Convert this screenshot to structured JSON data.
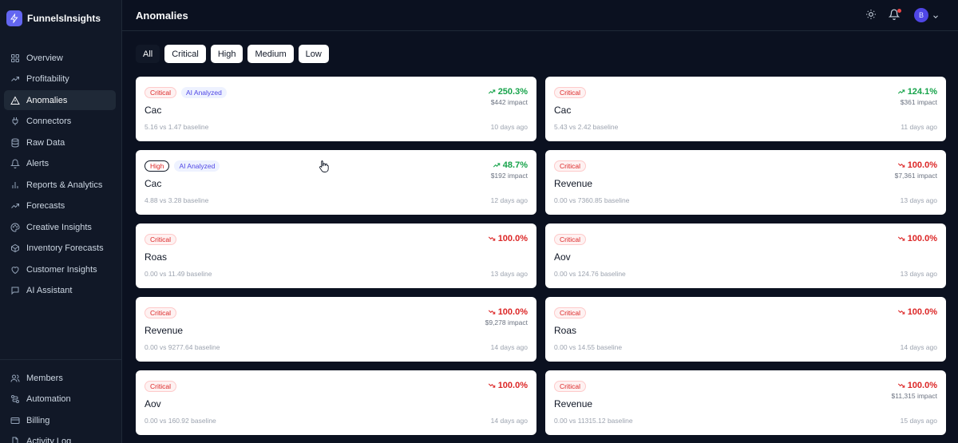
{
  "app": {
    "name": "FunnelsInsights"
  },
  "nav": {
    "items": [
      {
        "label": "Overview",
        "icon": "grid-icon"
      },
      {
        "label": "Profitability",
        "icon": "trending-icon"
      },
      {
        "label": "Anomalies",
        "icon": "alert-triangle-icon",
        "active": true
      },
      {
        "label": "Connectors",
        "icon": "plug-icon"
      },
      {
        "label": "Raw Data",
        "icon": "database-icon"
      },
      {
        "label": "Alerts",
        "icon": "bell-icon"
      },
      {
        "label": "Reports & Analytics",
        "icon": "bar-chart-icon"
      },
      {
        "label": "Forecasts",
        "icon": "trending-icon"
      },
      {
        "label": "Creative Insights",
        "icon": "palette-icon"
      },
      {
        "label": "Inventory Forecasts",
        "icon": "box-icon"
      },
      {
        "label": "Customer Insights",
        "icon": "heart-icon"
      },
      {
        "label": "AI Assistant",
        "icon": "chat-icon"
      }
    ],
    "bottom": [
      {
        "label": "Members",
        "icon": "users-icon"
      },
      {
        "label": "Automation",
        "icon": "workflow-icon"
      },
      {
        "label": "Billing",
        "icon": "credit-card-icon"
      },
      {
        "label": "Activity Log",
        "icon": "file-icon"
      }
    ]
  },
  "header": {
    "title": "Anomalies",
    "avatar_initial": "B"
  },
  "filters": [
    {
      "label": "All",
      "active": true
    },
    {
      "label": "Critical"
    },
    {
      "label": "High"
    },
    {
      "label": "Medium"
    },
    {
      "label": "Low"
    }
  ],
  "cards": [
    {
      "severity": "Critical",
      "ai": "AI Analyzed",
      "metric": "Cac",
      "baseline": "5.16 vs 1.47 baseline",
      "change": "250.3%",
      "direction": "up",
      "impact": "$442 impact",
      "time": "10 days ago"
    },
    {
      "severity": "Critical",
      "ai": "",
      "metric": "Cac",
      "baseline": "5.43 vs 2.42 baseline",
      "change": "124.1%",
      "direction": "up",
      "impact": "$361 impact",
      "time": "11 days ago"
    },
    {
      "severity": "High",
      "ai": "AI Analyzed",
      "metric": "Cac",
      "baseline": "4.88 vs 3.28 baseline",
      "change": "48.7%",
      "direction": "up",
      "impact": "$192 impact",
      "time": "12 days ago"
    },
    {
      "severity": "Critical",
      "ai": "",
      "metric": "Revenue",
      "baseline": "0.00 vs 7360.85 baseline",
      "change": "100.0%",
      "direction": "down",
      "impact": "$7,361 impact",
      "time": "13 days ago"
    },
    {
      "severity": "Critical",
      "ai": "",
      "metric": "Roas",
      "baseline": "0.00 vs 11.49 baseline",
      "change": "100.0%",
      "direction": "down",
      "impact": "",
      "time": "13 days ago"
    },
    {
      "severity": "Critical",
      "ai": "",
      "metric": "Aov",
      "baseline": "0.00 vs 124.76 baseline",
      "change": "100.0%",
      "direction": "down",
      "impact": "",
      "time": "13 days ago"
    },
    {
      "severity": "Critical",
      "ai": "",
      "metric": "Revenue",
      "baseline": "0.00 vs 9277.64 baseline",
      "change": "100.0%",
      "direction": "down",
      "impact": "$9,278 impact",
      "time": "14 days ago"
    },
    {
      "severity": "Critical",
      "ai": "",
      "metric": "Roas",
      "baseline": "0.00 vs 14.55 baseline",
      "change": "100.0%",
      "direction": "down",
      "impact": "",
      "time": "14 days ago"
    },
    {
      "severity": "Critical",
      "ai": "",
      "metric": "Aov",
      "baseline": "0.00 vs 160.92 baseline",
      "change": "100.0%",
      "direction": "down",
      "impact": "",
      "time": "14 days ago"
    },
    {
      "severity": "Critical",
      "ai": "",
      "metric": "Revenue",
      "baseline": "0.00 vs 11315.12 baseline",
      "change": "100.0%",
      "direction": "down",
      "impact": "$11,315 impact",
      "time": "15 days ago"
    }
  ]
}
